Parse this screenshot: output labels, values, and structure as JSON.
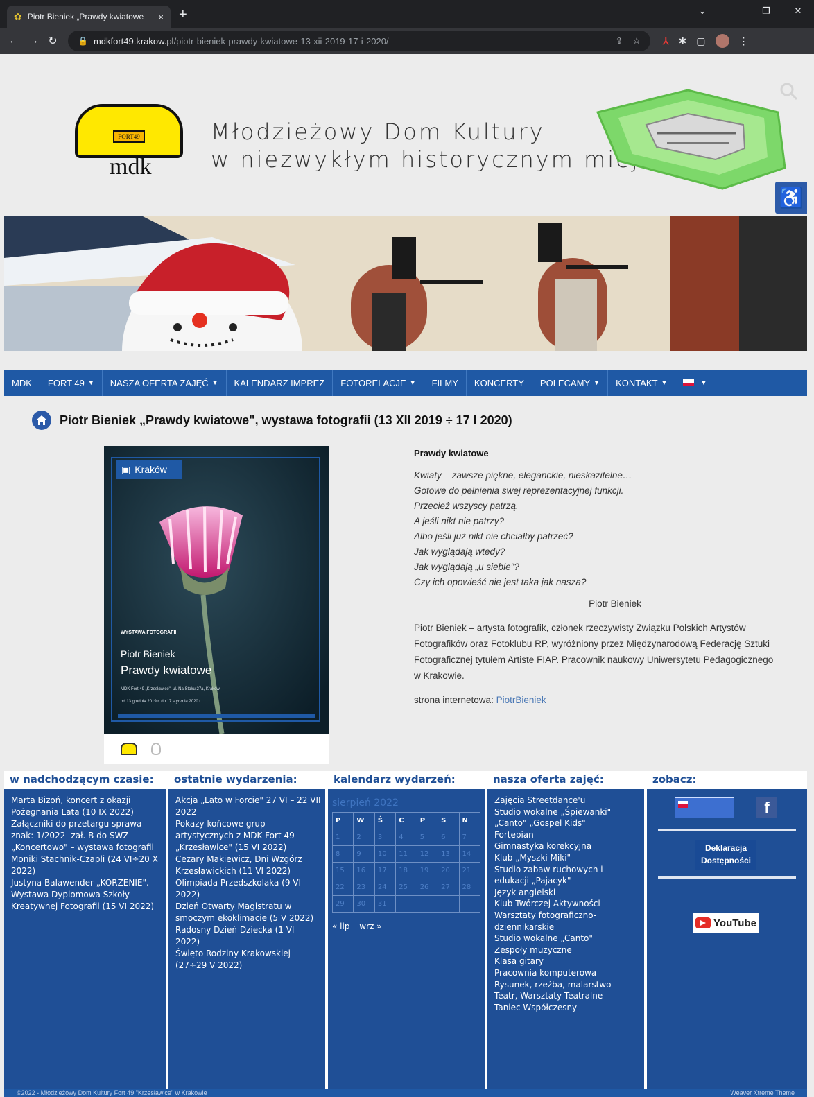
{
  "browser": {
    "tab_title": "Piotr Bieniek „Prawdy kwiatowe",
    "tab_close": "×",
    "new_tab": "+",
    "url_domain": "mdkfort49.krakow.pl",
    "url_path": "/piotr-bieniek-prawdy-kwiatowe-13-xii-2019-17-i-2020/"
  },
  "header": {
    "title_line1": "Młodzieżowy Dom Kultury",
    "title_line2": "w niezwykłym historycznym miejscu",
    "logo_fort": "FORT49",
    "logo_letters": "mdk"
  },
  "menu": [
    {
      "label": "MDK",
      "caret": false
    },
    {
      "label": "FORT 49",
      "caret": true
    },
    {
      "label": "NASZA OFERTA ZAJĘĆ",
      "caret": true
    },
    {
      "label": "KALENDARZ IMPREZ",
      "caret": false
    },
    {
      "label": "FOTORELACJE",
      "caret": true
    },
    {
      "label": "FILMY",
      "caret": false
    },
    {
      "label": "KONCERTY",
      "caret": false
    },
    {
      "label": "POLECAMY",
      "caret": true
    },
    {
      "label": "KONTAKT",
      "caret": true
    }
  ],
  "article": {
    "title": "Piotr Bieniek „Prawdy kwiatowe\", wystawa fotografii (13 XII 2019 ÷ 17 I 2020)",
    "subtitle": "Prawdy kwiatowe",
    "poem": [
      "Kwiaty – zawsze piękne, eleganckie, nieskazitelne…",
      "Gotowe do pełnienia swej reprezentacyjnej funkcji.",
      "Przecież wszyscy patrzą.",
      "A jeśli nikt nie patrzy?",
      "Albo jeśli już nikt nie chciałby patrzeć?",
      "Jak wyglądają wtedy?",
      "Jak wyglądają „u siebie\"?",
      "Czy ich opowieść nie jest taka jak nasza?"
    ],
    "signature": "Piotr Bieniek",
    "bio": "Piotr Bieniek – artysta fotografik, członek rzeczywisty Związku Polskich Artystów Fotografików oraz Fotoklubu RP, wyróżniony przez Międzynarodową Federację Sztuki Fotograficznej tytułem Artiste FIAP. Pracownik naukowy Uniwersytetu Pedagogicznego w Krakowie.",
    "web_label": "strona internetowa:",
    "web_link": "PiotrBieniek"
  },
  "poster": {
    "city": "Kraków",
    "kicker": "WYSTAWA FOTOGRAFII",
    "author": "Piotr Bieniek",
    "title": "Prawdy kwiatowe",
    "info1": "MDK Fort 49 „Krzesławice\", ul. Na Stoku 27a, Kraków",
    "info2": "od 13 grudnia 2019 r. do 17 stycznia 2020 r."
  },
  "widgets": {
    "upcoming": {
      "heading": "w nadchodzącym czasie:",
      "items": [
        "Marta Bizoń, koncert z okazji Pożegnania Lata (10 IX 2022)",
        "Załączniki do przetargu sprawa znak: 1/2022- zał. B do SWZ",
        "„Koncertowo\" – wystawa fotografii Moniki Stachnik-Czapli (24 VI÷20 X 2022)",
        "Justyna Balawender „KORZENIE\". Wystawa Dyplomowa Szkoły Kreatywnej Fotografii (15 VI 2022)"
      ]
    },
    "recent": {
      "heading": "ostatnie wydarzenia:",
      "items": [
        "Akcja „Lato w Forcie\" 27 VI – 22 VII 2022",
        "Pokazy końcowe grup artystycznych z MDK Fort 49 „Krzesławice\" (15 VI 2022)",
        "Cezary Makiewicz, Dni Wzgórz Krzesławickich (11 VI 2022)",
        "Olimpiada Przedszkolaka (9 VI 2022)",
        "Dzień Otwarty Magistratu w smoczym ekoklimacie (5 V 2022)",
        "Radosny Dzień Dziecka (1 VI 2022)",
        "Święto Rodziny Krakowskiej (27÷29 V 2022)"
      ]
    },
    "calendar": {
      "heading": "kalendarz wydarzeń:",
      "month": "sierpień 2022",
      "days": [
        "P",
        "W",
        "Ś",
        "C",
        "P",
        "S",
        "N"
      ],
      "weeks": [
        [
          "1",
          "2",
          "3",
          "4",
          "5",
          "6",
          "7"
        ],
        [
          "8",
          "9",
          "10",
          "11",
          "12",
          "13",
          "14"
        ],
        [
          "15",
          "16",
          "17",
          "18",
          "19",
          "20",
          "21"
        ],
        [
          "22",
          "23",
          "24",
          "25",
          "26",
          "27",
          "28"
        ],
        [
          "29",
          "30",
          "31",
          "",
          "",
          "",
          ""
        ]
      ],
      "prev": "« lip",
      "next": "wrz »"
    },
    "offer": {
      "heading": "nasza oferta zajęć:",
      "items": [
        "Zajęcia Streetdance'u",
        "Studio wokalne „Śpiewanki\"",
        "„Canto\" „Gospel Kids\"",
        "Fortepian",
        "Gimnastyka korekcyjna",
        "Klub „Myszki Miki\"",
        "Studio zabaw ruchowych i edukacji „Pajacyk\"",
        "Język angielski",
        "Klub Twórczej Aktywności",
        "Warsztaty fotograficzno-dziennikarskie",
        "Studio wokalne „Canto\"",
        "Zespoły muzyczne",
        "Klasa gitary",
        "Pracownia komputerowa",
        "Rysunek, rzeźba, malarstwo",
        "Teatr, Warsztaty Teatralne",
        "Taniec Współczesny"
      ]
    },
    "see": {
      "heading": "zobacz:",
      "fb": "f",
      "dekl_line1": "Deklaracja",
      "dekl_line2": "Dostępności",
      "youtube": "YouTube"
    }
  },
  "footer": {
    "left": "©2022 - Młodzieżowy Dom Kultury Fort 49 \"Krzesławice\" w Krakowie",
    "right": "Weaver Xtreme Theme"
  },
  "colors": {
    "menu_blue": "#1f59a5",
    "widget_blue": "#1f4f96",
    "logo_yellow": "#ffe800"
  }
}
